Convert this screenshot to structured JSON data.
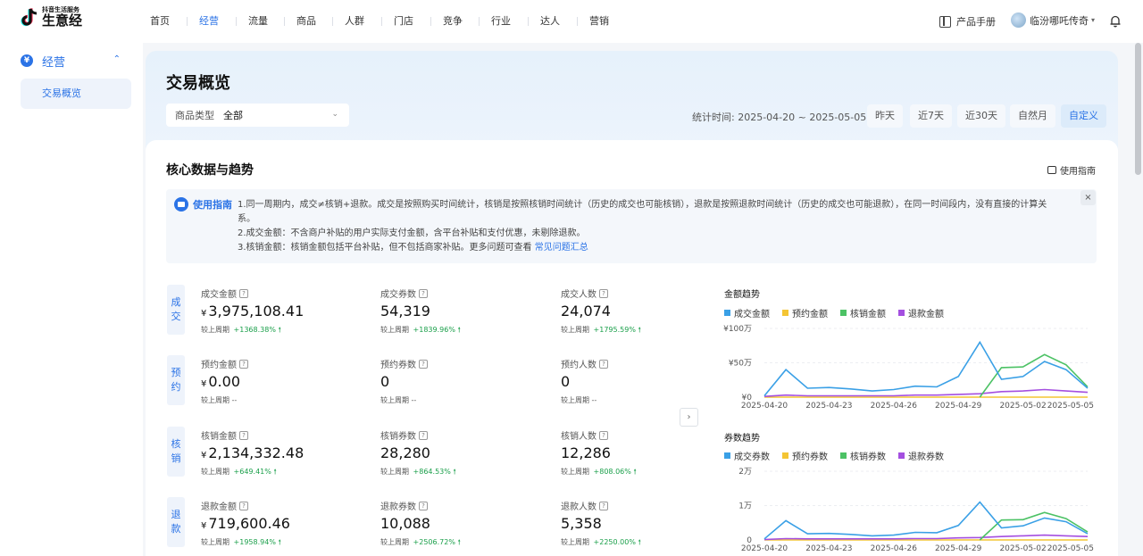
{
  "brand": {
    "sub": "抖音生活服务",
    "main": "生意经",
    "logo_icon": "tiktok-note-icon"
  },
  "nav": {
    "items": [
      {
        "label": "首页",
        "active": false
      },
      {
        "label": "经营",
        "active": true
      },
      {
        "label": "流量",
        "active": false
      },
      {
        "label": "商品",
        "active": false
      },
      {
        "label": "人群",
        "active": false
      },
      {
        "label": "门店",
        "active": false
      },
      {
        "label": "竞争",
        "active": false
      },
      {
        "label": "行业",
        "active": false
      },
      {
        "label": "达人",
        "active": false
      },
      {
        "label": "营销",
        "active": false
      }
    ],
    "manual_label": "产品手册",
    "user_name": "临汾哪吒传奇"
  },
  "sidebar": {
    "group_label": "经营",
    "group_icon": "yen-icon",
    "items": [
      {
        "label": "交易概览"
      }
    ]
  },
  "page": {
    "title": "交易概览",
    "filter_label": "商品类型",
    "filter_value": "全部",
    "stat_time": "统计时间: 2025-04-20 ~ 2025-05-05",
    "date_buttons": [
      {
        "label": "昨天",
        "active": false
      },
      {
        "label": "近7天",
        "active": false
      },
      {
        "label": "近30天",
        "active": false
      },
      {
        "label": "自然月",
        "active": false
      },
      {
        "label": "自定义",
        "active": true
      }
    ]
  },
  "section": {
    "title": "核心数据与趋势",
    "guide_link": "使用指南"
  },
  "notice": {
    "badge": "使用指南",
    "line1": "1.同一周期内，成交≠核销+退款。成交是按照购买时间统计，核销是按照核销时间统计（历史的成交也可能核销），退款是按照退款时间统计（历史的成交也可能退款），在同一时间段内，没有直接的计算关",
    "line1b": "系。",
    "line2": "2.成交金额：不含商户补贴的用户实际支付金额，含平台补贴和支付优惠，未剔除退款。",
    "line3": "3.核销金额：核销金额包括平台补贴，但不包括商家补贴。更多问题可查看",
    "line3_link": "常见问题汇总"
  },
  "metrics": {
    "comp_label": "较上周期",
    "rows": [
      {
        "tag": [
          "成",
          "交"
        ],
        "cells": [
          {
            "label": "成交金额",
            "yen": "¥",
            "value": "3,975,108.41",
            "change": "+1368.38%",
            "up": true
          },
          {
            "label": "成交券数",
            "yen": "",
            "value": "54,319",
            "change": "+1839.96%",
            "up": true
          },
          {
            "label": "成交人数",
            "yen": "",
            "value": "24,074",
            "change": "+1795.59%",
            "up": true
          }
        ]
      },
      {
        "tag": [
          "预",
          "约"
        ],
        "cells": [
          {
            "label": "预约金额",
            "yen": "¥",
            "value": "0.00",
            "change": "--",
            "up": false
          },
          {
            "label": "预约券数",
            "yen": "",
            "value": "0",
            "change": "--",
            "up": false
          },
          {
            "label": "预约人数",
            "yen": "",
            "value": "0",
            "change": "--",
            "up": false
          }
        ]
      },
      {
        "tag": [
          "核",
          "销"
        ],
        "cells": [
          {
            "label": "核销金额",
            "yen": "¥",
            "value": "2,134,332.48",
            "change": "+649.41%",
            "up": true
          },
          {
            "label": "核销券数",
            "yen": "",
            "value": "28,280",
            "change": "+864.53%",
            "up": true
          },
          {
            "label": "核销人数",
            "yen": "",
            "value": "12,286",
            "change": "+808.06%",
            "up": true
          }
        ]
      },
      {
        "tag": [
          "退",
          "款"
        ],
        "cells": [
          {
            "label": "退款金额",
            "yen": "¥",
            "value": "719,600.46",
            "change": "+1958.94%",
            "up": true
          },
          {
            "label": "退款券数",
            "yen": "",
            "value": "10,088",
            "change": "+2506.72%",
            "up": true
          },
          {
            "label": "退款人数",
            "yen": "",
            "value": "5,358",
            "change": "+2250.00%",
            "up": true
          }
        ]
      }
    ]
  },
  "colors": {
    "blue": "#3aa0e6",
    "yellow": "#f4c534",
    "green": "#4cc265",
    "purple": "#a44fe0",
    "accent": "#2b73e6",
    "up": "#1a9f4a"
  },
  "chart_data": [
    {
      "type": "line",
      "title": "金额趋势",
      "x": [
        "2025-04-20",
        "2025-04-21",
        "2025-04-22",
        "2025-04-23",
        "2025-04-24",
        "2025-04-25",
        "2025-04-26",
        "2025-04-27",
        "2025-04-28",
        "2025-04-29",
        "2025-04-30",
        "2025-05-01",
        "2025-05-02",
        "2025-05-03",
        "2025-05-04",
        "2025-05-05"
      ],
      "x_ticks": [
        "2025-04-20",
        "2025-04-23",
        "2025-04-26",
        "2025-04-29",
        "2025-05-02",
        "2025-05-05"
      ],
      "y_ticks": [
        "¥100万",
        "¥50万",
        "¥0"
      ],
      "ylim": [
        0,
        1000000
      ],
      "series": [
        {
          "name": "成交金额",
          "color": "#3aa0e6",
          "values": [
            20000,
            400000,
            130000,
            140000,
            120000,
            90000,
            110000,
            160000,
            150000,
            300000,
            800000,
            260000,
            300000,
            520000,
            400000,
            130000
          ]
        },
        {
          "name": "预约金额",
          "color": "#f4c534",
          "values": [
            0,
            0,
            0,
            0,
            0,
            0,
            0,
            0,
            0,
            0,
            0,
            0,
            0,
            0,
            0,
            0
          ]
        },
        {
          "name": "核销金额",
          "color": "#4cc265",
          "values": [
            0,
            0,
            0,
            0,
            0,
            0,
            0,
            0,
            0,
            0,
            0,
            430000,
            440000,
            620000,
            470000,
            150000
          ]
        },
        {
          "name": "退款金额",
          "color": "#a44fe0",
          "values": [
            10000,
            30000,
            20000,
            20000,
            20000,
            20000,
            20000,
            30000,
            30000,
            40000,
            50000,
            80000,
            90000,
            110000,
            90000,
            70000
          ]
        }
      ]
    },
    {
      "type": "line",
      "title": "券数趋势",
      "x": [
        "2025-04-20",
        "2025-04-21",
        "2025-04-22",
        "2025-04-23",
        "2025-04-24",
        "2025-04-25",
        "2025-04-26",
        "2025-04-27",
        "2025-04-28",
        "2025-04-29",
        "2025-04-30",
        "2025-05-01",
        "2025-05-02",
        "2025-05-03",
        "2025-05-04",
        "2025-05-05"
      ],
      "x_ticks": [
        "2025-04-20",
        "2025-04-23",
        "2025-04-26",
        "2025-04-29",
        "2025-05-02",
        "2025-05-05"
      ],
      "y_ticks": [
        "2万",
        "1万",
        "0"
      ],
      "ylim": [
        0,
        20000
      ],
      "series": [
        {
          "name": "成交券数",
          "color": "#3aa0e6",
          "values": [
            300,
            5600,
            1800,
            1900,
            1600,
            1200,
            1400,
            2200,
            2100,
            4200,
            11000,
            3500,
            4100,
            6400,
            5300,
            1800
          ]
        },
        {
          "name": "预约券数",
          "color": "#f4c534",
          "values": [
            0,
            0,
            0,
            0,
            0,
            0,
            0,
            0,
            0,
            0,
            0,
            0,
            0,
            0,
            0,
            0
          ]
        },
        {
          "name": "核销券数",
          "color": "#4cc265",
          "values": [
            0,
            0,
            0,
            0,
            0,
            0,
            0,
            0,
            0,
            0,
            0,
            5800,
            5900,
            8000,
            6200,
            2300
          ]
        },
        {
          "name": "退款券数",
          "color": "#a44fe0",
          "values": [
            100,
            400,
            300,
            300,
            300,
            300,
            300,
            400,
            400,
            600,
            700,
            1000,
            1200,
            1400,
            1200,
            1000
          ]
        }
      ]
    }
  ]
}
